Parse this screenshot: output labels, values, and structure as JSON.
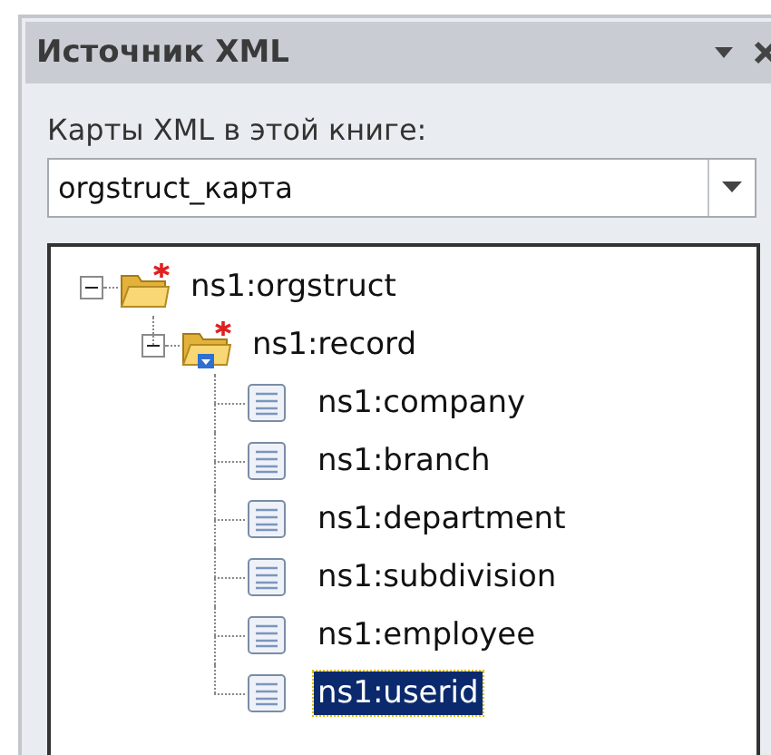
{
  "panel": {
    "title": "Источник XML"
  },
  "maps_label": "Карты XML в этой книге:",
  "map_select": {
    "value": "orgstruct_карта"
  },
  "tree": [
    {
      "kind": "folder",
      "label": "ns1:orgstruct",
      "expanded": true,
      "selected": false,
      "required": true,
      "repeating": false,
      "children": [
        {
          "kind": "folder",
          "label": "ns1:record",
          "expanded": true,
          "selected": false,
          "required": true,
          "repeating": true,
          "children": [
            {
              "kind": "leaf",
              "label": "ns1:company",
              "selected": false,
              "required": false,
              "repeating": false
            },
            {
              "kind": "leaf",
              "label": "ns1:branch",
              "selected": false,
              "required": false,
              "repeating": false
            },
            {
              "kind": "leaf",
              "label": "ns1:department",
              "selected": false,
              "required": false,
              "repeating": false
            },
            {
              "kind": "leaf",
              "label": "ns1:subdivision",
              "selected": false,
              "required": false,
              "repeating": false
            },
            {
              "kind": "leaf",
              "label": "ns1:employee",
              "selected": false,
              "required": false,
              "repeating": false
            },
            {
              "kind": "leaf",
              "label": "ns1:userid",
              "selected": true,
              "required": false,
              "repeating": false
            }
          ]
        }
      ]
    }
  ]
}
